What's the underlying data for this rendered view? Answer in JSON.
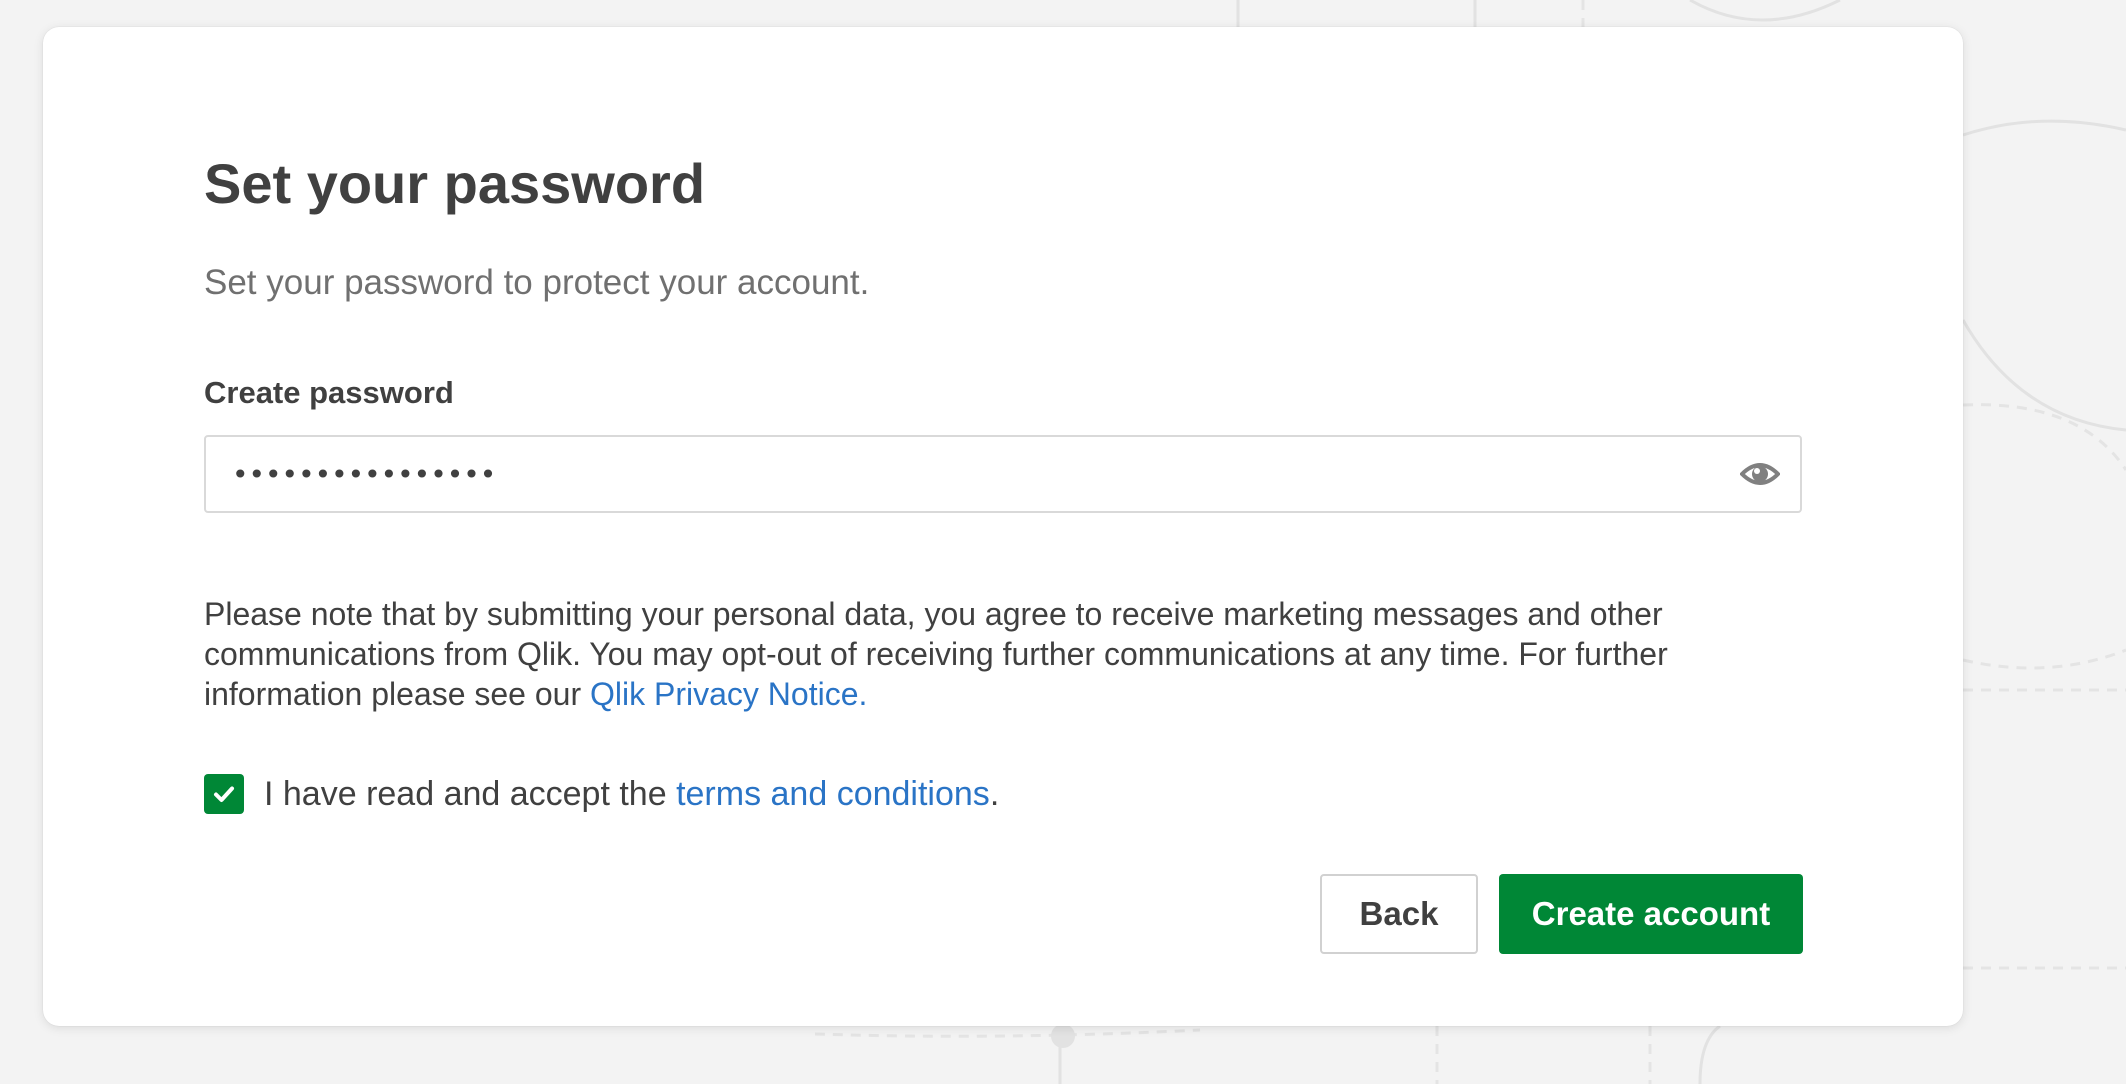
{
  "page": {
    "title": "Set your password",
    "subtitle": "Set your password to protect your account."
  },
  "password": {
    "label": "Create password",
    "value": "••••••••••••••••",
    "toggle_icon": "eye-icon"
  },
  "notice": {
    "text": "Please note that by submitting your personal data, you agree to receive marketing messages and other communications from Qlik. You may opt-out of receiving further communications at any time. For further information please see our ",
    "link_text": "Qlik Privacy Notice."
  },
  "terms": {
    "checked": true,
    "prefix": "I have read and accept the ",
    "link_text": "terms and conditions",
    "suffix": "."
  },
  "buttons": {
    "back_label": "Back",
    "create_label": "Create account"
  },
  "colors": {
    "accent": "#008736",
    "link": "#2a74c6",
    "text": "#404040",
    "muted": "#707070",
    "background": "#f3f3f3"
  }
}
